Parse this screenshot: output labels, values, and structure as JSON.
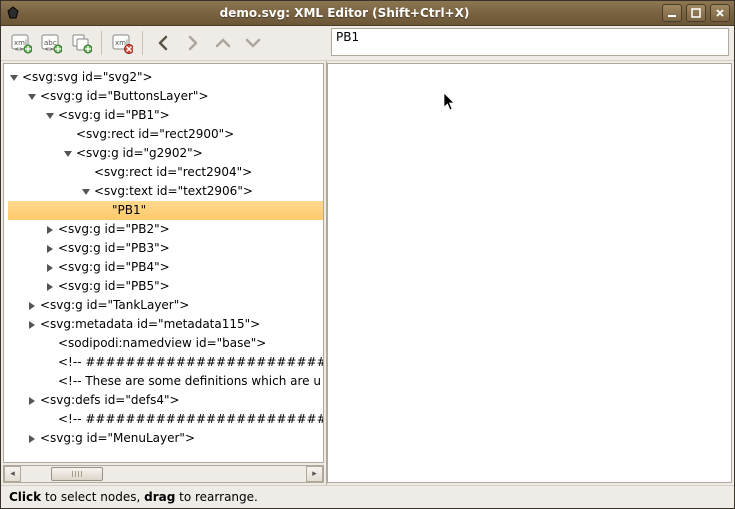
{
  "window": {
    "title": "demo.svg: XML Editor (Shift+Ctrl+X)"
  },
  "editor": {
    "value_field": "PB1"
  },
  "tree": {
    "rows": [
      {
        "indent": 0,
        "expander": "open",
        "label": "<svg:svg id=\"svg2\">",
        "selected": false
      },
      {
        "indent": 18,
        "expander": "open",
        "label": "<svg:g id=\"ButtonsLayer\">",
        "selected": false
      },
      {
        "indent": 36,
        "expander": "open",
        "label": "<svg:g id=\"PB1\">",
        "selected": false
      },
      {
        "indent": 54,
        "expander": "none",
        "label": "<svg:rect id=\"rect2900\">",
        "selected": false
      },
      {
        "indent": 54,
        "expander": "open",
        "label": "<svg:g id=\"g2902\">",
        "selected": false
      },
      {
        "indent": 72,
        "expander": "none",
        "label": "<svg:rect id=\"rect2904\">",
        "selected": false
      },
      {
        "indent": 72,
        "expander": "open",
        "label": "<svg:text id=\"text2906\">",
        "selected": false
      },
      {
        "indent": 90,
        "expander": "none",
        "label": "\"PB1\"",
        "selected": true
      },
      {
        "indent": 36,
        "expander": "closed",
        "label": "<svg:g id=\"PB2\">",
        "selected": false
      },
      {
        "indent": 36,
        "expander": "closed",
        "label": "<svg:g id=\"PB3\">",
        "selected": false
      },
      {
        "indent": 36,
        "expander": "closed",
        "label": "<svg:g id=\"PB4\">",
        "selected": false
      },
      {
        "indent": 36,
        "expander": "closed",
        "label": "<svg:g id=\"PB5\">",
        "selected": false
      },
      {
        "indent": 18,
        "expander": "closed",
        "label": "<svg:g id=\"TankLayer\">",
        "selected": false
      },
      {
        "indent": 18,
        "expander": "closed",
        "label": "<svg:metadata id=\"metadata115\">",
        "selected": false
      },
      {
        "indent": 36,
        "expander": "none",
        "label": "<sodipodi:namedview id=\"base\">",
        "selected": false
      },
      {
        "indent": 36,
        "expander": "none",
        "label": "<!-- #########################",
        "selected": false
      },
      {
        "indent": 36,
        "expander": "none",
        "label": "<!-- These are some definitions which are u",
        "selected": false
      },
      {
        "indent": 18,
        "expander": "closed",
        "label": "<svg:defs id=\"defs4\">",
        "selected": false
      },
      {
        "indent": 36,
        "expander": "none",
        "label": "<!-- #########################",
        "selected": false
      },
      {
        "indent": 18,
        "expander": "closed",
        "label": "<svg:g id=\"MenuLayer\">",
        "selected": false
      }
    ]
  },
  "statusbar": {
    "click_word": "Click",
    "mid_text": " to select nodes, ",
    "drag_word": "drag",
    "end_text": " to rearrange."
  },
  "icons": {
    "new_element": "new-element-node-icon",
    "new_text": "new-text-node-icon",
    "duplicate": "duplicate-node-icon",
    "delete": "delete-node-icon",
    "nav_back": "nav-back-icon",
    "nav_forward": "nav-forward-icon",
    "nav_up": "nav-up-icon",
    "nav_down": "nav-down-icon"
  }
}
